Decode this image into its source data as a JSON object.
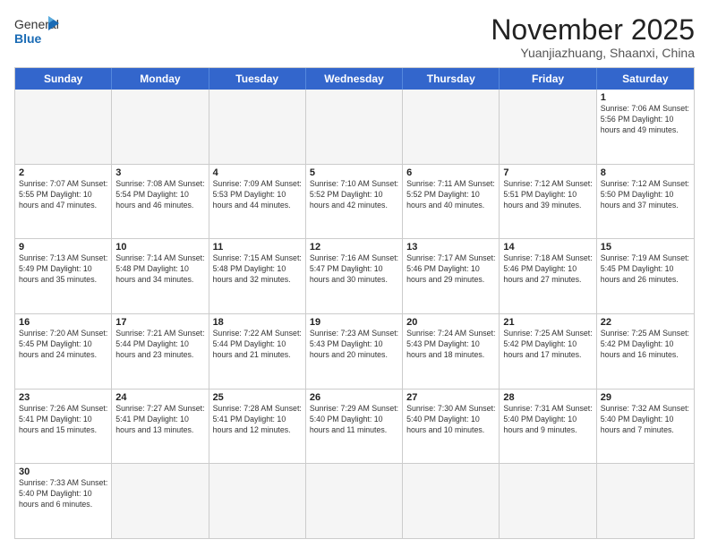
{
  "header": {
    "logo_general": "General",
    "logo_blue": "Blue",
    "title": "November 2025",
    "subtitle": "Yuanjiazhuang, Shaanxi, China"
  },
  "days_of_week": [
    "Sunday",
    "Monday",
    "Tuesday",
    "Wednesday",
    "Thursday",
    "Friday",
    "Saturday"
  ],
  "weeks": [
    [
      {
        "day": "",
        "info": "",
        "empty": true
      },
      {
        "day": "",
        "info": "",
        "empty": true
      },
      {
        "day": "",
        "info": "",
        "empty": true
      },
      {
        "day": "",
        "info": "",
        "empty": true
      },
      {
        "day": "",
        "info": "",
        "empty": true
      },
      {
        "day": "",
        "info": "",
        "empty": true
      },
      {
        "day": "1",
        "info": "Sunrise: 7:06 AM\nSunset: 5:56 PM\nDaylight: 10 hours\nand 49 minutes."
      }
    ],
    [
      {
        "day": "2",
        "info": "Sunrise: 7:07 AM\nSunset: 5:55 PM\nDaylight: 10 hours\nand 47 minutes."
      },
      {
        "day": "3",
        "info": "Sunrise: 7:08 AM\nSunset: 5:54 PM\nDaylight: 10 hours\nand 46 minutes."
      },
      {
        "day": "4",
        "info": "Sunrise: 7:09 AM\nSunset: 5:53 PM\nDaylight: 10 hours\nand 44 minutes."
      },
      {
        "day": "5",
        "info": "Sunrise: 7:10 AM\nSunset: 5:52 PM\nDaylight: 10 hours\nand 42 minutes."
      },
      {
        "day": "6",
        "info": "Sunrise: 7:11 AM\nSunset: 5:52 PM\nDaylight: 10 hours\nand 40 minutes."
      },
      {
        "day": "7",
        "info": "Sunrise: 7:12 AM\nSunset: 5:51 PM\nDaylight: 10 hours\nand 39 minutes."
      },
      {
        "day": "8",
        "info": "Sunrise: 7:12 AM\nSunset: 5:50 PM\nDaylight: 10 hours\nand 37 minutes."
      }
    ],
    [
      {
        "day": "9",
        "info": "Sunrise: 7:13 AM\nSunset: 5:49 PM\nDaylight: 10 hours\nand 35 minutes."
      },
      {
        "day": "10",
        "info": "Sunrise: 7:14 AM\nSunset: 5:48 PM\nDaylight: 10 hours\nand 34 minutes."
      },
      {
        "day": "11",
        "info": "Sunrise: 7:15 AM\nSunset: 5:48 PM\nDaylight: 10 hours\nand 32 minutes."
      },
      {
        "day": "12",
        "info": "Sunrise: 7:16 AM\nSunset: 5:47 PM\nDaylight: 10 hours\nand 30 minutes."
      },
      {
        "day": "13",
        "info": "Sunrise: 7:17 AM\nSunset: 5:46 PM\nDaylight: 10 hours\nand 29 minutes."
      },
      {
        "day": "14",
        "info": "Sunrise: 7:18 AM\nSunset: 5:46 PM\nDaylight: 10 hours\nand 27 minutes."
      },
      {
        "day": "15",
        "info": "Sunrise: 7:19 AM\nSunset: 5:45 PM\nDaylight: 10 hours\nand 26 minutes."
      }
    ],
    [
      {
        "day": "16",
        "info": "Sunrise: 7:20 AM\nSunset: 5:45 PM\nDaylight: 10 hours\nand 24 minutes."
      },
      {
        "day": "17",
        "info": "Sunrise: 7:21 AM\nSunset: 5:44 PM\nDaylight: 10 hours\nand 23 minutes."
      },
      {
        "day": "18",
        "info": "Sunrise: 7:22 AM\nSunset: 5:44 PM\nDaylight: 10 hours\nand 21 minutes."
      },
      {
        "day": "19",
        "info": "Sunrise: 7:23 AM\nSunset: 5:43 PM\nDaylight: 10 hours\nand 20 minutes."
      },
      {
        "day": "20",
        "info": "Sunrise: 7:24 AM\nSunset: 5:43 PM\nDaylight: 10 hours\nand 18 minutes."
      },
      {
        "day": "21",
        "info": "Sunrise: 7:25 AM\nSunset: 5:42 PM\nDaylight: 10 hours\nand 17 minutes."
      },
      {
        "day": "22",
        "info": "Sunrise: 7:25 AM\nSunset: 5:42 PM\nDaylight: 10 hours\nand 16 minutes."
      }
    ],
    [
      {
        "day": "23",
        "info": "Sunrise: 7:26 AM\nSunset: 5:41 PM\nDaylight: 10 hours\nand 15 minutes."
      },
      {
        "day": "24",
        "info": "Sunrise: 7:27 AM\nSunset: 5:41 PM\nDaylight: 10 hours\nand 13 minutes."
      },
      {
        "day": "25",
        "info": "Sunrise: 7:28 AM\nSunset: 5:41 PM\nDaylight: 10 hours\nand 12 minutes."
      },
      {
        "day": "26",
        "info": "Sunrise: 7:29 AM\nSunset: 5:40 PM\nDaylight: 10 hours\nand 11 minutes."
      },
      {
        "day": "27",
        "info": "Sunrise: 7:30 AM\nSunset: 5:40 PM\nDaylight: 10 hours\nand 10 minutes."
      },
      {
        "day": "28",
        "info": "Sunrise: 7:31 AM\nSunset: 5:40 PM\nDaylight: 10 hours\nand 9 minutes."
      },
      {
        "day": "29",
        "info": "Sunrise: 7:32 AM\nSunset: 5:40 PM\nDaylight: 10 hours\nand 7 minutes."
      }
    ],
    [
      {
        "day": "30",
        "info": "Sunrise: 7:33 AM\nSunset: 5:40 PM\nDaylight: 10 hours\nand 6 minutes."
      },
      {
        "day": "",
        "info": "",
        "empty": true
      },
      {
        "day": "",
        "info": "",
        "empty": true
      },
      {
        "day": "",
        "info": "",
        "empty": true
      },
      {
        "day": "",
        "info": "",
        "empty": true
      },
      {
        "day": "",
        "info": "",
        "empty": true
      },
      {
        "day": "",
        "info": "",
        "empty": true
      }
    ]
  ]
}
